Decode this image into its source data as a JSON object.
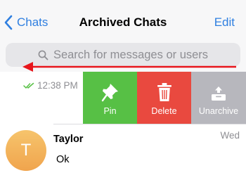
{
  "nav": {
    "back_label": "Chats",
    "title": "Archived Chats",
    "edit_label": "Edit"
  },
  "search": {
    "placeholder": "Search for messages or users"
  },
  "archived_row": {
    "time": "12:38 PM",
    "status_icon": "double-check-icon"
  },
  "swipe_actions": [
    {
      "label": "Pin",
      "icon": "pin-icon",
      "color": "#57c045"
    },
    {
      "label": "Delete",
      "icon": "trash-icon",
      "color": "#e9493f"
    },
    {
      "label": "Unarchive",
      "icon": "unarchive-icon",
      "color": "#b7b7bd"
    }
  ],
  "chat": {
    "avatar_initial": "T",
    "name": "Taylor",
    "message": "Ok",
    "time": "Wed"
  },
  "colors": {
    "accent": "#2f7fe0",
    "arrow": "#e8161c"
  }
}
